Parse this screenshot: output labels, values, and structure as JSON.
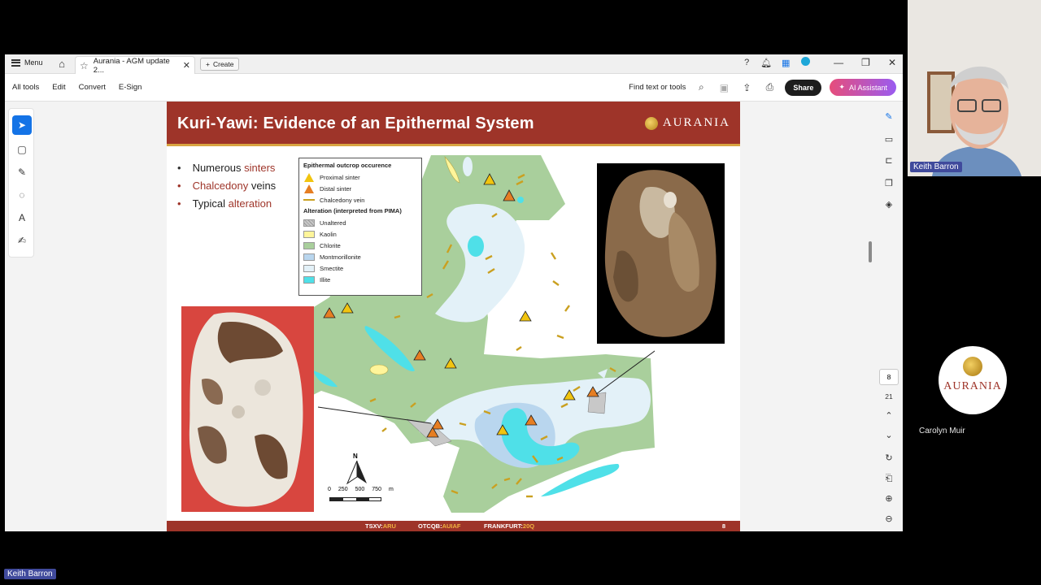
{
  "app": {
    "menu_label": "Menu",
    "tab_title": "Aurania - AGM update 2...",
    "create_label": "Create"
  },
  "toolbar": {
    "items": [
      "All tools",
      "Edit",
      "Convert",
      "E-Sign"
    ],
    "find_label": "Find text or tools",
    "share_label": "Share",
    "ai_label": "AI Assistant"
  },
  "page_nav": {
    "current": "8",
    "total": "21"
  },
  "slide": {
    "title": "Kuri-Yawi: Evidence of an Epithermal System",
    "logo_text": "AURANIA",
    "bullets": [
      {
        "pre": "Numerous ",
        "accent": "sinters",
        "post": ""
      },
      {
        "pre": "",
        "accent": "Chalcedony",
        "post": " veins"
      },
      {
        "pre": "Typical ",
        "accent": "alteration",
        "post": ""
      }
    ],
    "legend": {
      "heading1": "Epithermal outcrop occurence",
      "proximal": "Proximal sinter",
      "distal": "Distal sinter",
      "vein": "Chalcedony vein",
      "heading2": "Alteration (interpreted from PIMA)",
      "classes": [
        {
          "label": "Unaltered",
          "color": "#c8c8c8"
        },
        {
          "label": "Kaolin",
          "color": "#fff59a"
        },
        {
          "label": "Chlorite",
          "color": "#a9cf9c"
        },
        {
          "label": "Montmorillonite",
          "color": "#b9d6ee"
        },
        {
          "label": "Smectite",
          "color": "#e3f1f8"
        },
        {
          "label": "Illite",
          "color": "#4fe0e8"
        }
      ]
    },
    "north_label": "N",
    "scale_labels": [
      "0",
      "250",
      "500",
      "750",
      "m"
    ],
    "footer": {
      "tsxv_label": "TSXV:",
      "tsxv": "ARU",
      "otc_label": "OTCQB:",
      "otc": "AUIAF",
      "fra_label": "FRANKFURT:",
      "fra": "20Q",
      "page": "8"
    }
  },
  "participants": {
    "speaker": "Keith Barron",
    "other": "Carolyn Muir",
    "other_avatar_text": "AURANIA",
    "bottom_label": "Keith Barron"
  }
}
